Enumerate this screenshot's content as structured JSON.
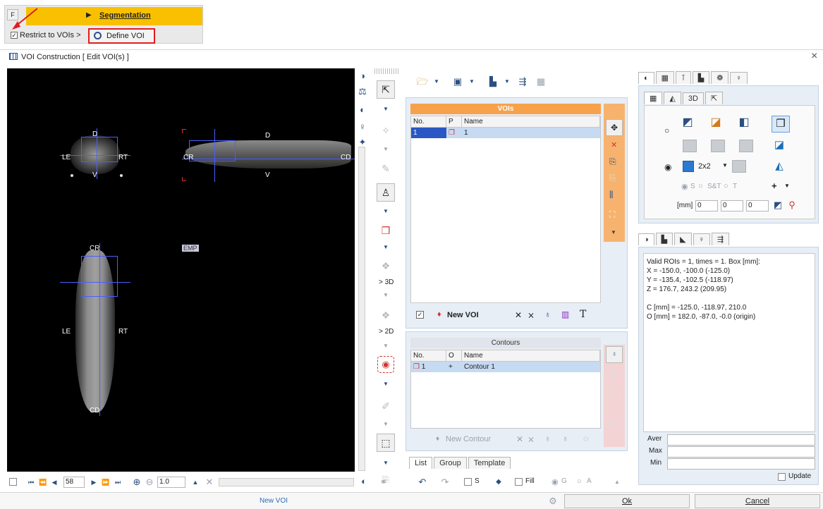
{
  "top_strip": {
    "f_button": "F",
    "segmentation_label": "Segmentation",
    "restrict_label": "Restrict to VOIs >",
    "define_voi_label": "Define VOI"
  },
  "window": {
    "title": "VOI Construction [ Edit VOI(s) ]",
    "close": "×"
  },
  "viewer": {
    "labels": {
      "top_d": "D",
      "top_le": "LE",
      "top_rt": "RT",
      "top_v": "V",
      "sag_d": "D",
      "sag_cr": "CR",
      "sag_cd": "CD",
      "sag_v": "V",
      "cor_cr": "CR",
      "cor_le": "LE",
      "cor_rt": "RT",
      "cor_cd": "CD",
      "emp": "EMP"
    },
    "slice": "58",
    "zoom": "1.0"
  },
  "mid_toolbar": {
    "to_3d": "> 3D",
    "to_2d": "> 2D"
  },
  "vois": {
    "header": "VOIs",
    "col_no": "No.",
    "col_p": "P",
    "col_name": "Name",
    "rows": [
      {
        "no": "1",
        "name": "1"
      }
    ],
    "new_voi": "New VOI"
  },
  "contours": {
    "header": "Contours",
    "col_no": "No.",
    "col_o": "O",
    "col_name": "Name",
    "rows": [
      {
        "no": "1",
        "o": "+",
        "name": "Contour 1"
      }
    ],
    "new_contour": "New Contour"
  },
  "bottom_tabs": [
    "List",
    "Group",
    "Template"
  ],
  "bottom_controls": {
    "s_label": "S",
    "fill_label": "Fill",
    "g_label": "G",
    "a_label": "A"
  },
  "right_top": {
    "tab_3d": "3D",
    "grid_label": "2x2",
    "radio_s": "S",
    "radio_st": "S&T",
    "radio_t": "T",
    "mm_label": "[mm]",
    "mm_values": [
      "0",
      "0",
      "0"
    ],
    "small_boxes": [
      "1",
      "1",
      "1",
      "1",
      "1",
      "1"
    ],
    "grid_box": "1"
  },
  "info": {
    "lines": [
      "Valid ROIs = 1, times = 1.  Box [mm]:",
      "X = -150.0, -100.0 (-125.0)",
      "Y = -135.4, -102.5 (-118.97)",
      "Z = 176.7, 243.2 (209.95)",
      "",
      "C [mm] = -125.0, -118.97, 210.0",
      "O [mm] = 182.0, -87.0, -0.0 (origin)"
    ],
    "aver_label": "Aver",
    "max_label": "Max",
    "min_label": "Min",
    "update_label": "Update"
  },
  "status": {
    "message": "New VOI",
    "ok": "Ok",
    "cancel": "Cancel"
  }
}
